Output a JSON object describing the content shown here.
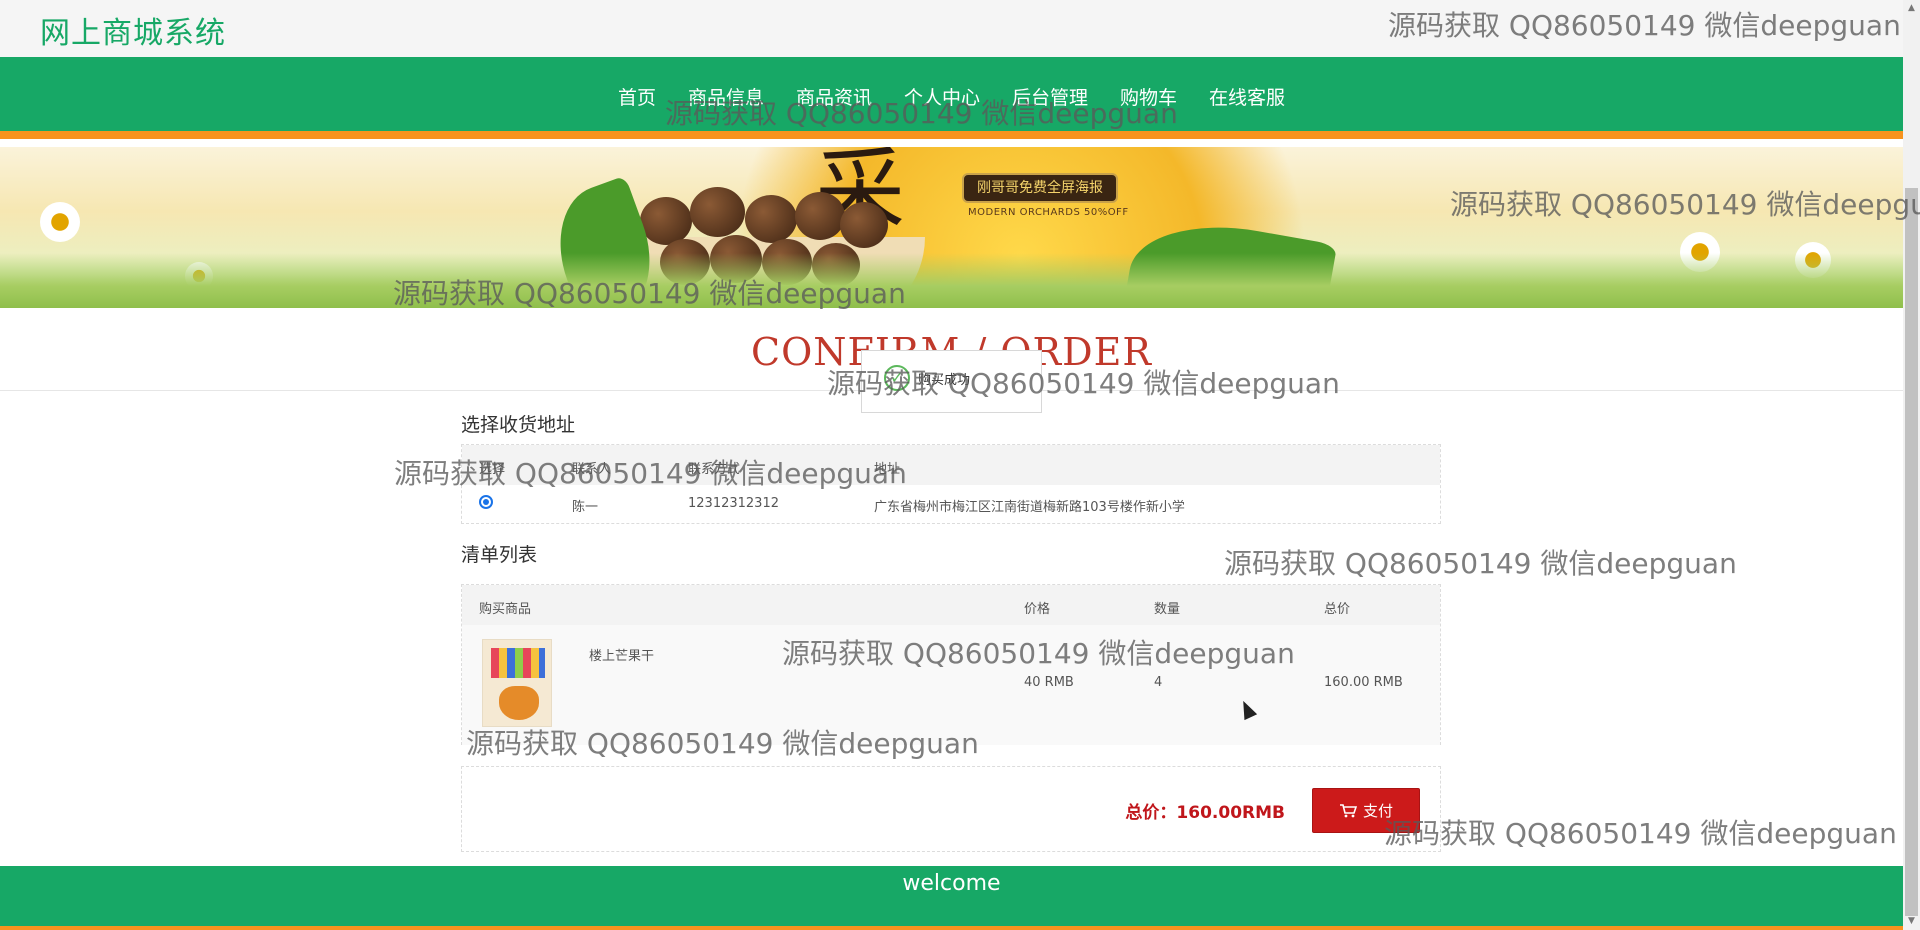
{
  "site": {
    "title": "网上商城系统"
  },
  "nav": {
    "items": [
      {
        "label": "首页"
      },
      {
        "label": "商品信息"
      },
      {
        "label": "商品资讯"
      },
      {
        "label": "个人中心"
      },
      {
        "label": "后台管理"
      },
      {
        "label": "购物车"
      },
      {
        "label": "在线客服"
      }
    ]
  },
  "banner": {
    "char": "采",
    "badge": "刚哥哥免费全屏海报",
    "subtitle": "MODERN ORCHARDS 50%OFF"
  },
  "heading": "CONFIRM / ORDER",
  "toast": {
    "icon": "check-circle-icon",
    "text": "购买成功"
  },
  "address_section": {
    "title": "选择收货地址",
    "columns": [
      "选择",
      "联系人",
      "联系方式",
      "地址"
    ],
    "rows": [
      {
        "selected": true,
        "contact": "陈一",
        "phone": "12312312312",
        "address": "广东省梅州市梅江区江南街道梅新路103号楼作新小学"
      }
    ]
  },
  "items_section": {
    "title": "清单列表",
    "columns": [
      "购买商品",
      "价格",
      "数量",
      "总价"
    ],
    "rows": [
      {
        "name": "楼上芒果干",
        "price": "40 RMB",
        "quantity": "4",
        "total": "160.00 RMB"
      }
    ]
  },
  "summary": {
    "total_label": "总价：160.00RMB",
    "pay_label": "支付",
    "pay_icon": "cart-icon"
  },
  "footer": {
    "text": "welcome"
  },
  "watermark": "源码获取 QQ86050149 微信deepguan",
  "colors": {
    "primary": "#17a866",
    "accent": "#f7931e",
    "danger": "#cc1a1a",
    "heading": "#c0392b"
  }
}
